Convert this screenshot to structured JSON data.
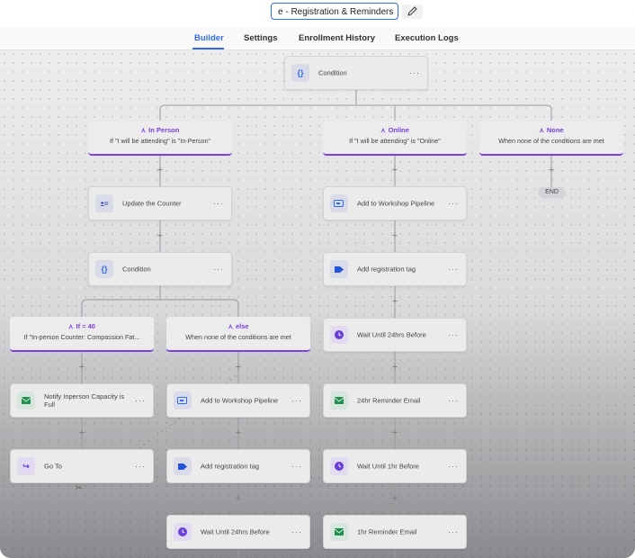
{
  "header": {
    "workflow_title": "e - Registration & Reminders",
    "edit_icon": "pencil-icon"
  },
  "tabs": [
    {
      "label": "Builder",
      "active": true
    },
    {
      "label": "Settings",
      "active": false
    },
    {
      "label": "Enrollment History",
      "active": false
    },
    {
      "label": "Execution Logs",
      "active": false
    }
  ],
  "colors": {
    "accent": "#2f6cf6",
    "branch": "#7b3fe4",
    "email": "#1f8f4e",
    "wait": "#6a3fd8",
    "tag": "#2453d6",
    "pipeline": "#2f6cf6"
  },
  "more_label": "···",
  "plus_label": "+",
  "nodes": {
    "root_condition": {
      "label": "Condition",
      "icon": "condition-icon"
    },
    "update_counter": {
      "label": "Update the Counter",
      "icon": "math-operations-icon"
    },
    "inner_condition": {
      "label": "Condition",
      "icon": "condition-icon"
    },
    "notify_capacity": {
      "label": "Notify Inperson Capacity is Full",
      "icon": "email-icon"
    },
    "go_to": {
      "label": "Go To",
      "icon": "goto-icon"
    },
    "else_pipeline": {
      "label": "Add to Workshop Pipeline",
      "icon": "pipeline-icon"
    },
    "else_tag": {
      "label": "Add registration tag",
      "icon": "tag-icon"
    },
    "else_wait": {
      "label": "Wait Until 24hrs Before",
      "icon": "wait-icon"
    },
    "online_pipeline": {
      "label": "Add to Workshop Pipeline",
      "icon": "pipeline-icon"
    },
    "online_tag": {
      "label": "Add registration tag",
      "icon": "tag-icon"
    },
    "online_wait24": {
      "label": "Wait Until 24hrs Before",
      "icon": "wait-icon"
    },
    "online_email24": {
      "label": "24hr Reminder Email",
      "icon": "email-icon"
    },
    "online_wait1": {
      "label": "Wait Until 1hr Before",
      "icon": "wait-icon"
    },
    "online_email1": {
      "label": "1hr Reminder Email",
      "icon": "email-icon"
    }
  },
  "branches": {
    "in_person": {
      "title": "In Person",
      "subtitle": "If \"I will be attending\" is \"In-Person\""
    },
    "online": {
      "title": "Online",
      "subtitle": "If \"I will be attending\" is \"Online\""
    },
    "none": {
      "title": "None",
      "subtitle": "When none of the conditions are met"
    },
    "if40": {
      "title": "If = 40",
      "subtitle": "If \"In-person Counter: Compassion Fat..."
    },
    "else": {
      "title": "else",
      "subtitle": "When none of the conditions are met"
    }
  },
  "end_label": "END"
}
